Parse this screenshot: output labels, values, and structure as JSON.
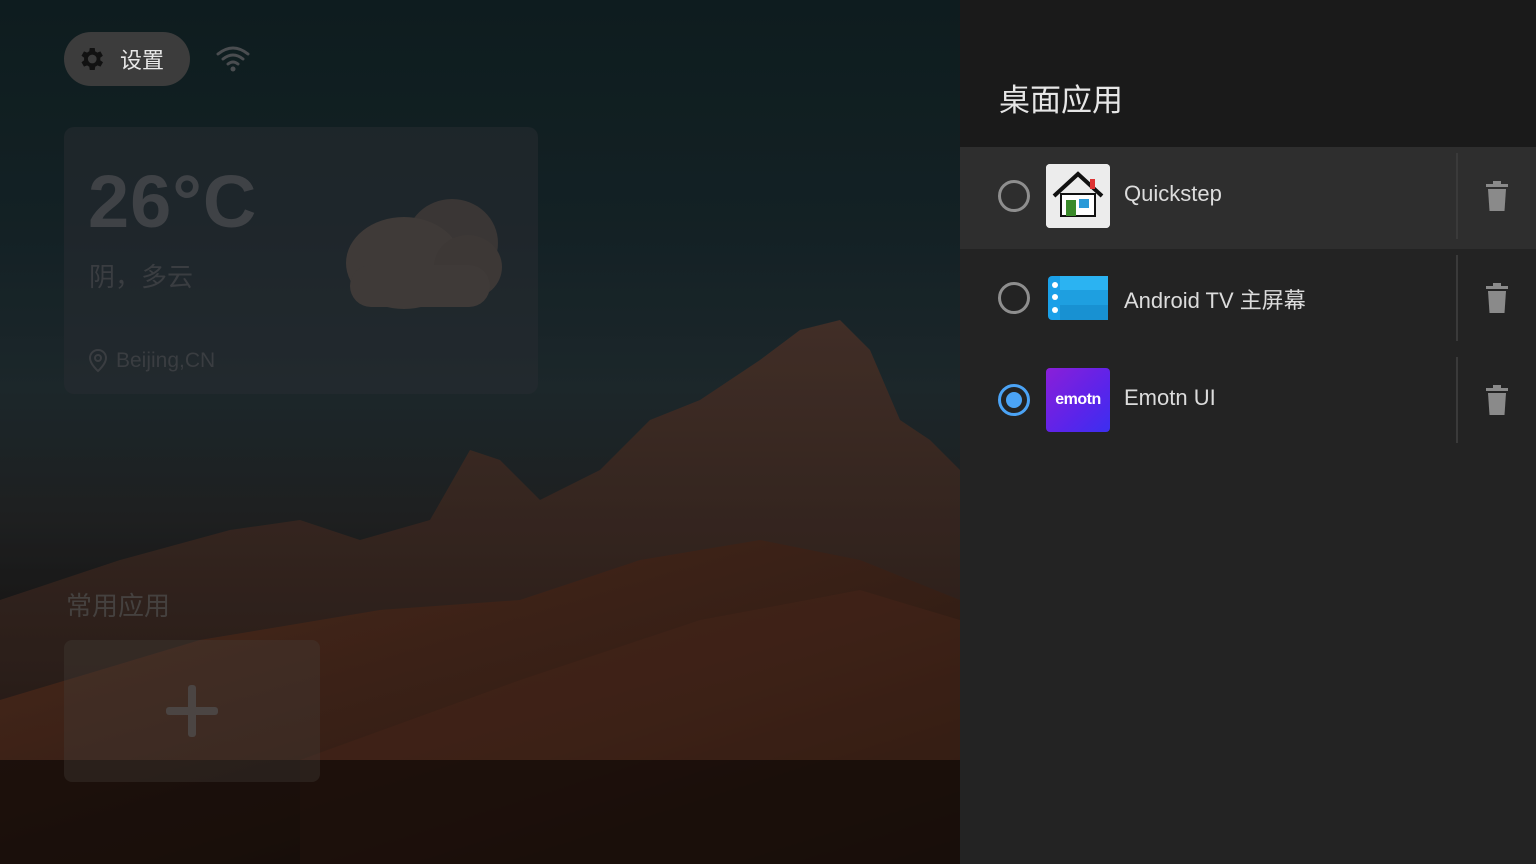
{
  "launcher": {
    "settings_label": "设置",
    "weather": {
      "temperature": "26°C",
      "condition": "阴，多云",
      "location": "Beijing,CN"
    },
    "favorites_title": "常用应用"
  },
  "panel": {
    "title": "桌面应用",
    "apps": [
      {
        "name": "Quickstep",
        "icon": "house-icon",
        "selected": false,
        "focused": true
      },
      {
        "name": "Android TV 主屏幕",
        "icon": "android-tv-home-icon",
        "selected": false,
        "focused": false
      },
      {
        "name": "Emotn UI",
        "icon": "emotn-icon",
        "icon_text": "emotn",
        "selected": true,
        "focused": false
      }
    ]
  },
  "colors": {
    "accent": "#4ba3f5",
    "panel_bg": "#232323",
    "header_bg": "#1a1a1a"
  }
}
